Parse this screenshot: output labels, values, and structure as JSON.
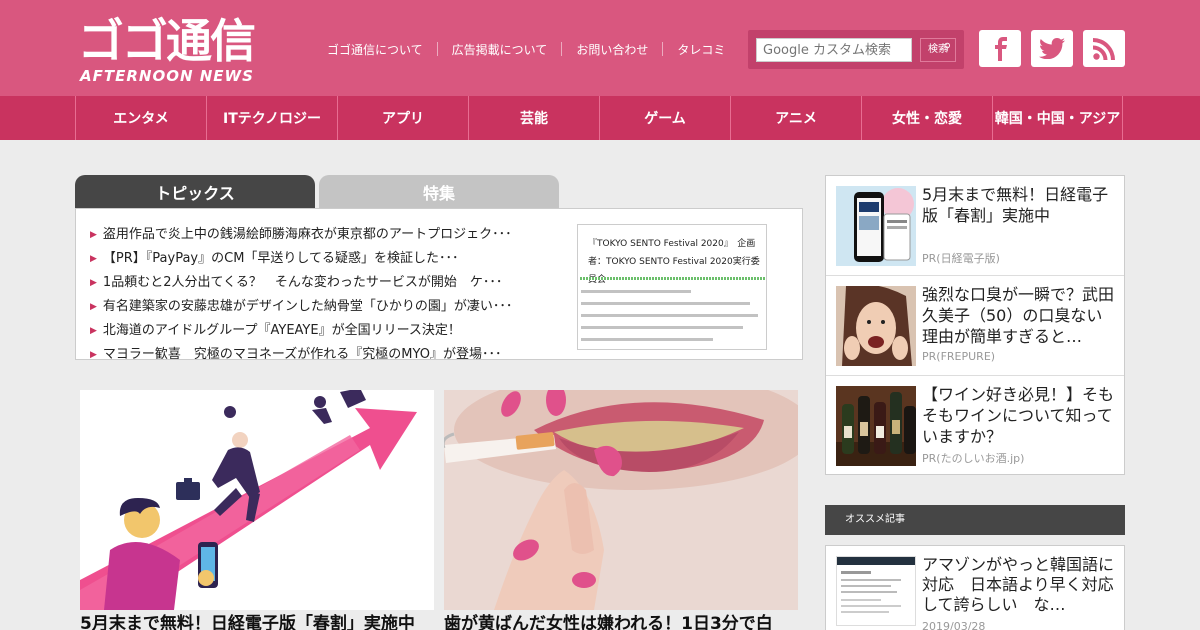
{
  "header": {
    "logo_text": "ゴゴ通信",
    "logo_sub": "AFTERNOON NEWS",
    "links": [
      "ゴゴ通信について",
      "広告掲載について",
      "お問い合わせ",
      "タレコミ"
    ],
    "search": {
      "placeholder": "Google カスタム検索",
      "button_label": "検索"
    },
    "social": [
      "facebook-icon",
      "twitter-icon",
      "rss-icon"
    ]
  },
  "nav": {
    "items": [
      "エンタメ",
      "ITテクノロジー",
      "アプリ",
      "芸能",
      "ゲーム",
      "アニメ",
      "女性・恋愛",
      "韓国・中国・アジア"
    ]
  },
  "topics": {
    "tabs": [
      "トピックス",
      "特集"
    ],
    "items": [
      "盗用作品で炎上中の銭湯絵師勝海麻衣が東京都のアートプロジェク･･･",
      "【PR】『PayPay』のCM「早送りしてる疑惑」を検証した･･･",
      "1品頼むと2人分出てくる？　そんな変わったサービスが開始　ケ･･･",
      "有名建築家の安藤忠雄がデザインした納骨堂「ひかりの園」が凄い･･･",
      "北海道のアイドルグループ『AYEAYE』が全国リリース決定！",
      "マヨラー歓喜　究極のマヨネーズが作れる『究極のMYO』が登場･･･"
    ],
    "thumb_title": "『TOKYO SENTO Festival 2020』　企画者：TOKYO SENTO Festival 2020実行委員会"
  },
  "cards": [
    {
      "title": "5月末まで無料！日経電子版「春割」実施中"
    },
    {
      "title": "歯が黄ばんだ女性は嫌われる！1日3分で白"
    }
  ],
  "ads": [
    {
      "title": "5月末まで無料！日経電子版「春割」実施中",
      "source": "PR(日経電子版)"
    },
    {
      "title": "強烈な口臭が一瞬で？武田久美子（50）の口臭ない理由が簡単すぎると…",
      "source": "PR(FREPURE)"
    },
    {
      "title": "【ワイン好き必見！】そもそもワインについて知っていますか？",
      "source": "PR(たのしいお酒.jp)"
    }
  ],
  "recommended": {
    "heading": "オススメ記事",
    "items": [
      {
        "title": "アマゾンがやっと韓国語に対応　日本語より早く対応して誇らしい　な…",
        "date": "2019/03/28"
      }
    ]
  },
  "colors": {
    "header_bg": "#d9577f",
    "nav_bg": "#c9335f",
    "tab_active": "#464646",
    "tab_inactive": "#c4c4c4"
  }
}
